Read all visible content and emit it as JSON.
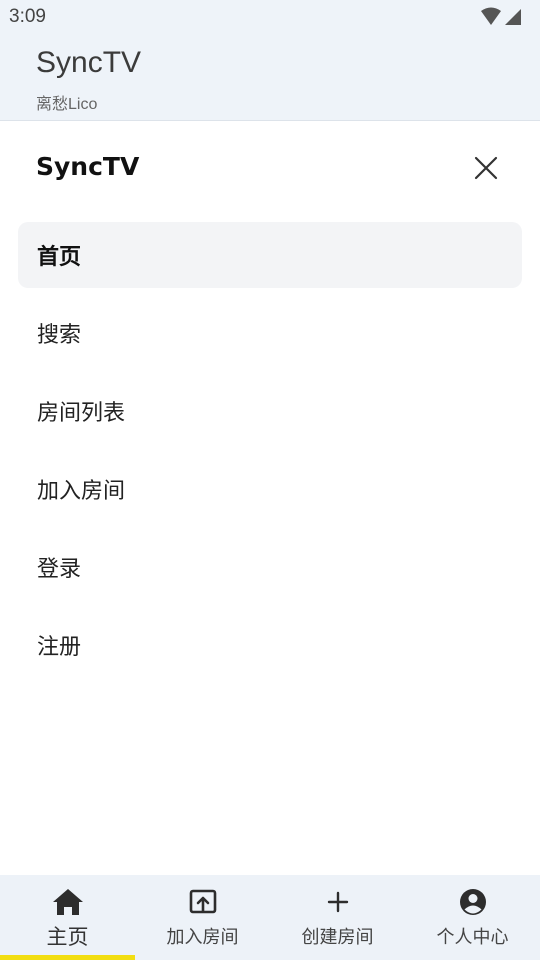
{
  "status_bar": {
    "time": "3:09"
  },
  "app_bar": {
    "title": "SyncTV",
    "subtitle": "离愁Lico"
  },
  "drawer": {
    "title": "SyncTV",
    "items": [
      {
        "label": "首页",
        "active": true
      },
      {
        "label": "搜索"
      },
      {
        "label": "房间列表"
      },
      {
        "label": "加入房间"
      },
      {
        "label": "登录"
      },
      {
        "label": "注册"
      }
    ]
  },
  "bottom_nav": {
    "tabs": [
      {
        "label": "主页",
        "icon": "home-icon",
        "active": true
      },
      {
        "label": "加入房间",
        "icon": "enter-room-icon"
      },
      {
        "label": "创建房间",
        "icon": "plus-icon"
      },
      {
        "label": "个人中心",
        "icon": "account-icon"
      }
    ],
    "indicator_color": "#f2de12"
  },
  "colors": {
    "top_bar_bg": "#eef3f9",
    "bottom_nav_bg": "#edf2f8",
    "active_item_bg": "#f3f4f6"
  }
}
